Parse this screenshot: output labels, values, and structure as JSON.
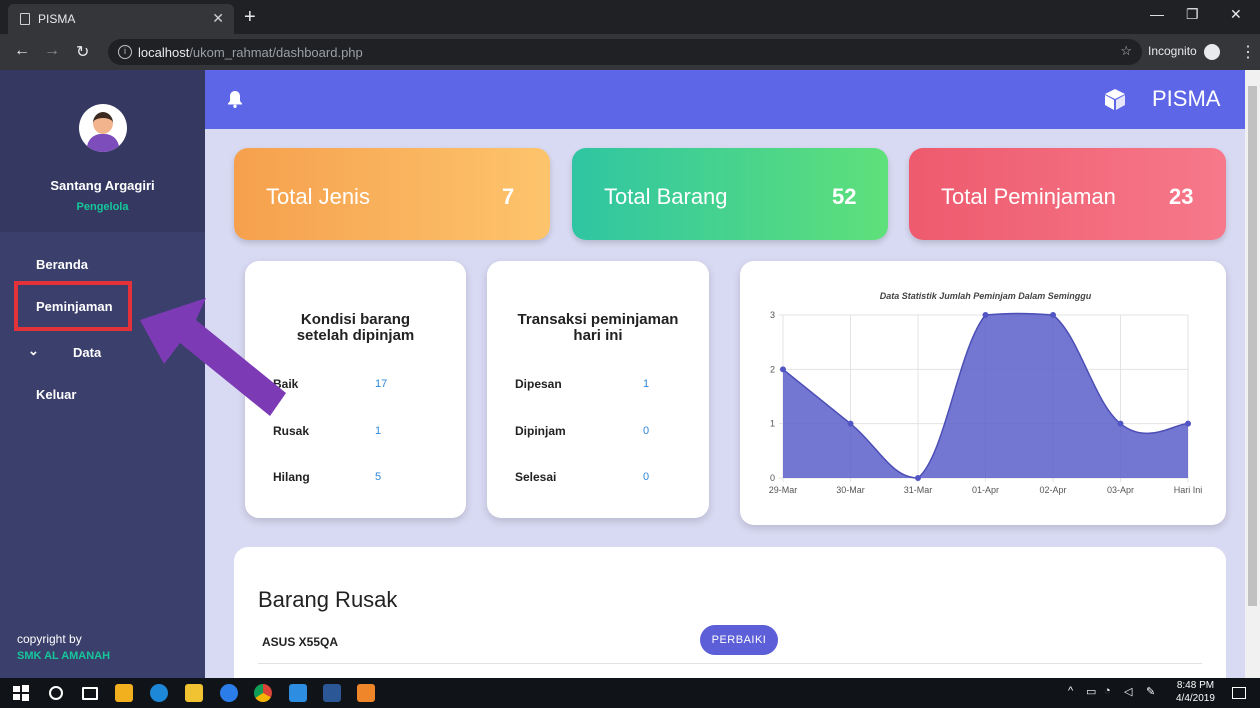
{
  "browser": {
    "tab_title": "PISMA",
    "new_tab": "+",
    "url_host": "localhost",
    "url_path": "/ukom_rahmat/dashboard.php",
    "incognito_label": "Incognito"
  },
  "sidebar": {
    "user_name": "Santang Argagiri",
    "user_role": "Pengelola",
    "items": [
      {
        "label": "Beranda"
      },
      {
        "label": "Peminjaman"
      },
      {
        "label": "Data"
      },
      {
        "label": "Keluar"
      }
    ],
    "copyright_label": "copyright by",
    "copyright_org": "SMK AL AMANAH"
  },
  "header": {
    "brand": "PISMA"
  },
  "stats": [
    {
      "label": "Total Jenis",
      "value": "7",
      "gradient": [
        "#f6a04d",
        "#fdc46c"
      ]
    },
    {
      "label": "Total Barang",
      "value": "52",
      "gradient": [
        "#2fc5a2",
        "#5fe07a"
      ]
    },
    {
      "label": "Total Peminjaman",
      "value": "23",
      "gradient": [
        "#ee5a6e",
        "#f6798a"
      ]
    }
  ],
  "kondisi": {
    "title_line1": "Kondisi barang",
    "title_line2": "setelah dipinjam",
    "rows": [
      {
        "label": "Baik",
        "value": "17"
      },
      {
        "label": "Rusak",
        "value": "1"
      },
      {
        "label": "Hilang",
        "value": "5"
      }
    ]
  },
  "transaksi": {
    "title_line1": "Transaksi peminjaman",
    "title_line2": "hari ini",
    "rows": [
      {
        "label": "Dipesan",
        "value": "1"
      },
      {
        "label": "Dipinjam",
        "value": "0"
      },
      {
        "label": "Selesai",
        "value": "0"
      }
    ]
  },
  "chart_data": {
    "type": "area",
    "title": "Data Statistik Jumlah Peminjam Dalam Seminggu",
    "categories": [
      "29-Mar",
      "30-Mar",
      "31-Mar",
      "01-Apr",
      "02-Apr",
      "03-Apr",
      "Hari Ini"
    ],
    "values": [
      2,
      1,
      0,
      3,
      3,
      1,
      1
    ],
    "ylim": [
      0,
      3
    ],
    "yticks": [
      "0",
      "1",
      "2",
      "3"
    ],
    "grid": true,
    "color": "#5c5fc9"
  },
  "barang_rusak": {
    "title": "Barang Rusak",
    "items": [
      {
        "name": "ASUS X55QA",
        "action": "PERBAIKI"
      }
    ]
  },
  "taskbar": {
    "time": "8:48 PM",
    "date": "4/4/2019"
  },
  "colors": {
    "sidebar": "#3b3f6b",
    "topbar": "#5d66e6",
    "accent_green": "#16c79a",
    "highlight_red": "#e3323a",
    "arrow_purple": "#7d3ab5"
  }
}
